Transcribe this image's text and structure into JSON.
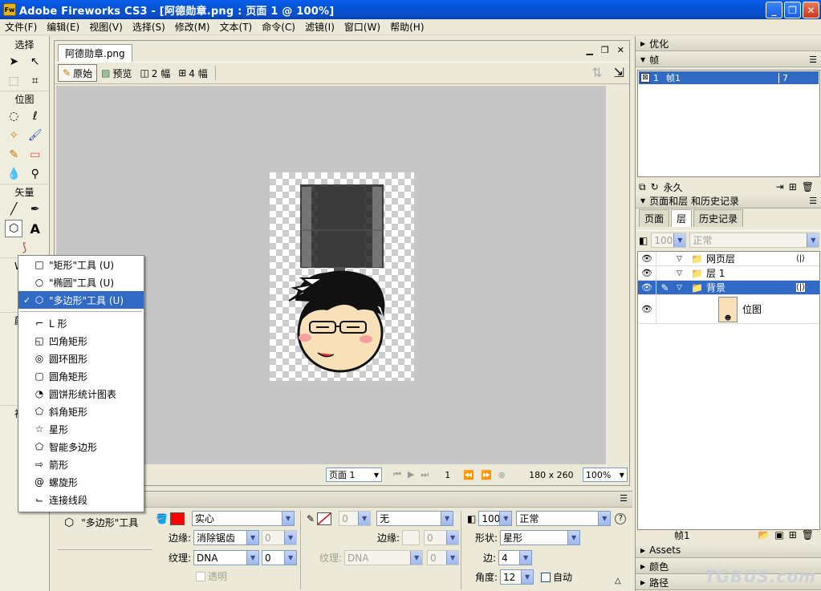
{
  "window": {
    "title": "Adobe Fireworks CS3 - [阿德勋章.png : 页面 1 @ 100%]",
    "app_icon": "Fw"
  },
  "menubar": [
    "文件(F)",
    "编辑(E)",
    "视图(V)",
    "选择(S)",
    "修改(M)",
    "文本(T)",
    "命令(C)",
    "滤镜(I)",
    "窗口(W)",
    "帮助(H)"
  ],
  "toolbox": {
    "sections": {
      "select": "选择",
      "bitmap": "位图",
      "vector": "矢量"
    },
    "partial_labels": {
      "web": "W",
      "color": "颜",
      "view": "视"
    }
  },
  "document": {
    "tab": "阿德勋章.png",
    "views": [
      {
        "label": "原始",
        "icon": "pencil-icon",
        "active": true
      },
      {
        "label": "预览",
        "icon": "preview-icon",
        "active": false
      },
      {
        "label": "2 幅",
        "icon": "two-up-icon",
        "active": false
      },
      {
        "label": "4 幅",
        "icon": "four-up-icon",
        "active": false
      }
    ],
    "status": {
      "page": "页面 1",
      "frame": "1",
      "size": "180 x 260",
      "zoom": "100%"
    }
  },
  "popup_menu": {
    "items": [
      {
        "label": "\"矩形\"工具 (U)",
        "icon": "rectangle-icon",
        "checked": false,
        "selected": false
      },
      {
        "label": "\"椭圆\"工具 (U)",
        "icon": "ellipse-icon",
        "checked": false,
        "selected": false
      },
      {
        "label": "\"多边形\"工具 (U)",
        "icon": "polygon-icon",
        "checked": true,
        "selected": true
      }
    ],
    "auto_shapes": [
      {
        "label": "L 形",
        "icon": "l-shape-icon"
      },
      {
        "label": "凹角矩形",
        "icon": "chamfer-rect-icon"
      },
      {
        "label": "圆环图形",
        "icon": "donut-icon"
      },
      {
        "label": "圆角矩形",
        "icon": "rounded-rect-icon"
      },
      {
        "label": "圆饼形统计图表",
        "icon": "pie-icon"
      },
      {
        "label": "斜角矩形",
        "icon": "bevel-rect-icon"
      },
      {
        "label": "星形",
        "icon": "star-icon"
      },
      {
        "label": "智能多边形",
        "icon": "smart-polygon-icon"
      },
      {
        "label": "箭形",
        "icon": "arrow-icon"
      },
      {
        "label": "螺旋形",
        "icon": "spiral-icon"
      },
      {
        "label": "连接线段",
        "icon": "connector-icon"
      }
    ]
  },
  "properties": {
    "tool_name": "\"多边形\"工具",
    "fill": {
      "color": "#ff0000",
      "type": "实心",
      "edge_label": "边缘:",
      "edge": "消除锯齿",
      "edge_amount": "0",
      "texture_label": "纹理:",
      "texture": "DNA",
      "texture_amount": "0",
      "transparent": "透明"
    },
    "stroke": {
      "amount": "0",
      "type": "无",
      "edge_label": "边缘:",
      "edge_amount": "0",
      "texture_label": "纹理:",
      "texture": "DNA",
      "texture_amount": "0"
    },
    "opacity": "100",
    "blend": "正常",
    "shape_label": "形状:",
    "shape": "星形",
    "sides_label": "边:",
    "sides": "4",
    "angle_label": "角度:",
    "angle": "12",
    "auto_label": "自动"
  },
  "right_panels": {
    "optimize": "优化",
    "frames": {
      "title": "帧",
      "rows": [
        {
          "num": "1",
          "name": "帧1",
          "delay": "7"
        }
      ],
      "loop": "永久"
    },
    "pages_layers": {
      "title": "页面和层 和历史记录",
      "tabs": [
        {
          "label": "页面",
          "active": false
        },
        {
          "label": "层",
          "active": true
        },
        {
          "label": "历史记录",
          "active": false
        }
      ],
      "opacity": "100",
      "blend": "正常",
      "layers": [
        {
          "name": "网页层",
          "selected": false,
          "indent": 0
        },
        {
          "name": "层 1",
          "selected": false,
          "indent": 0
        },
        {
          "name": "背景",
          "selected": true,
          "indent": 0
        },
        {
          "name": "位图",
          "selected": false,
          "indent": 1
        }
      ],
      "footer": "帧1"
    },
    "assets": "Assets",
    "colors": "颜色",
    "paths": "路径"
  },
  "watermark": "TGBUS.com"
}
